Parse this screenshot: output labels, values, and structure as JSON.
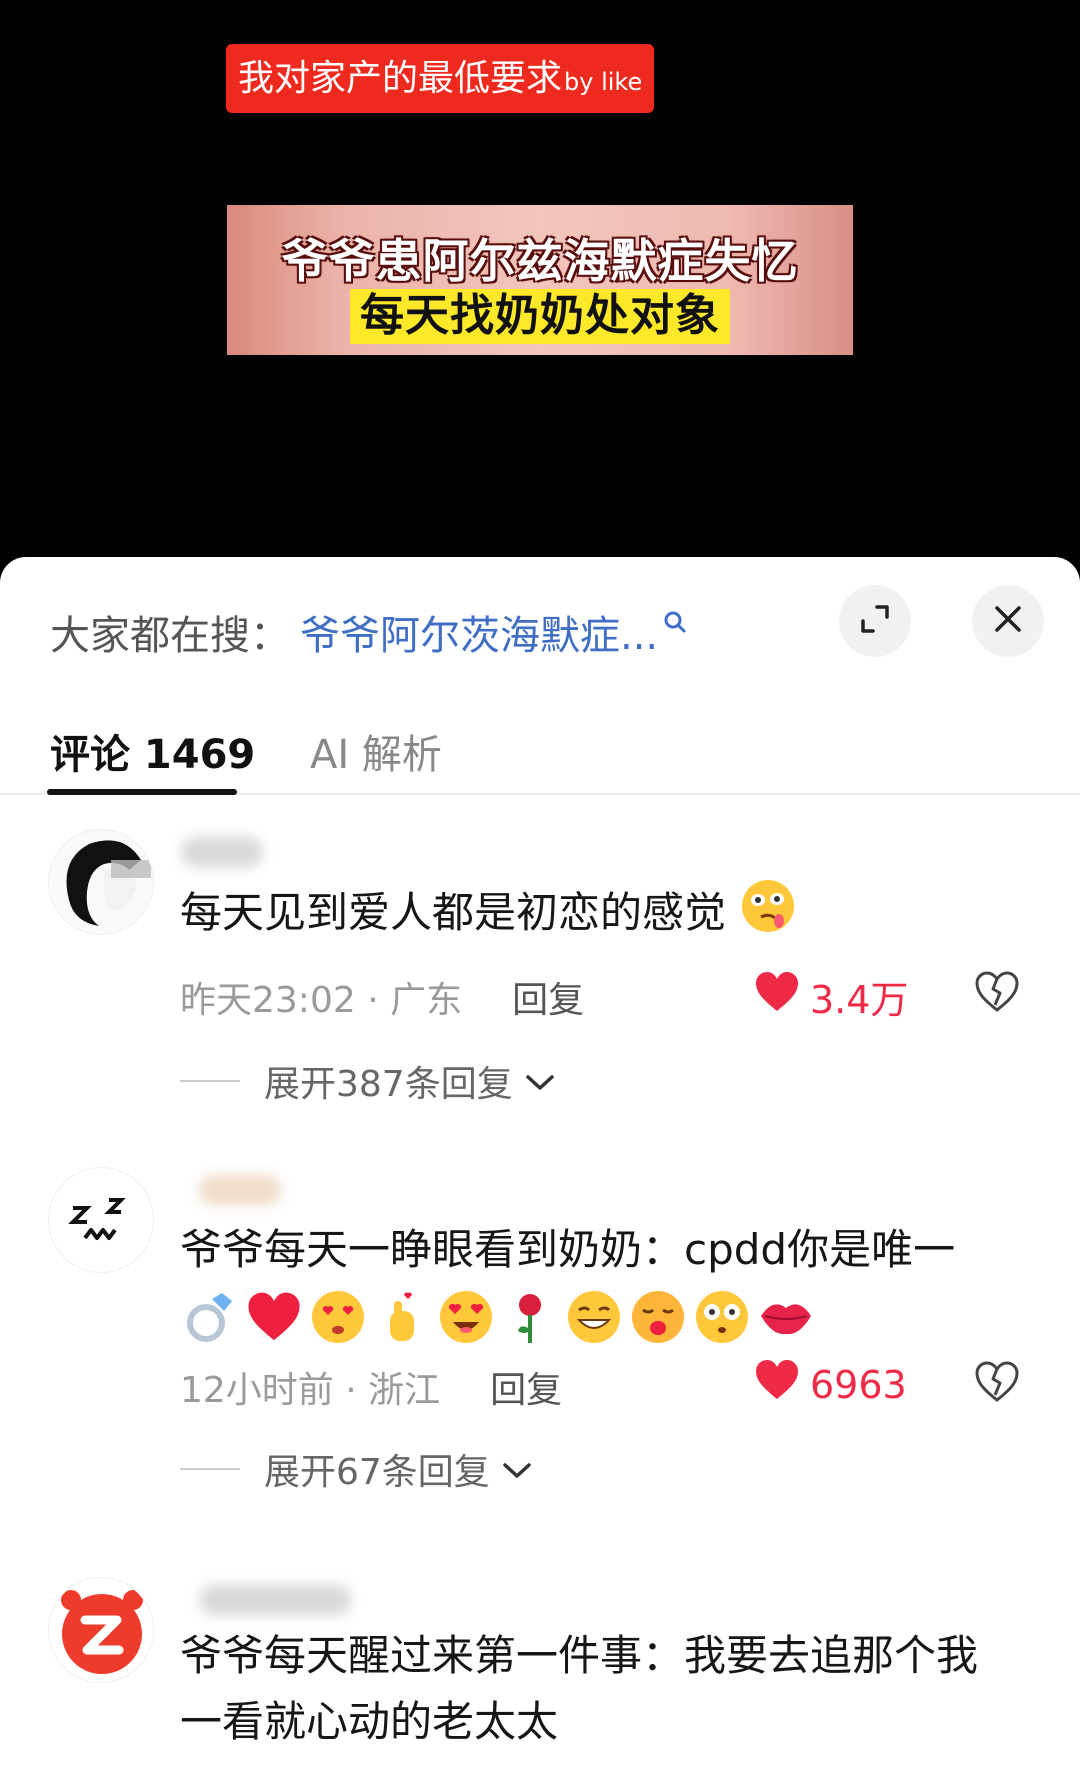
{
  "video": {
    "top_caption": "我对家产的最低要求",
    "top_caption_by": "by like",
    "headline_1": "爷爷患阿尔兹海默症失忆",
    "headline_2": "每天找奶奶处对象"
  },
  "search": {
    "prefix": "大家都在搜：",
    "query": "爷爷阿尔茨海默症...",
    "search_icon": "search-icon"
  },
  "header_buttons": {
    "expand_icon": "expand-icon",
    "close_icon": "close-icon"
  },
  "tabs": [
    {
      "label": "评论 1469",
      "active": true
    },
    {
      "label": "AI 解析",
      "active": false
    }
  ],
  "comments": [
    {
      "text": "每天见到爱人都是初恋的感觉",
      "time_location": "昨天23:02 · 广东",
      "reply_label": "回复",
      "likes": "3.4万",
      "expand_label": "展开387条回复"
    },
    {
      "text": "爷爷每天一睁眼看到奶奶：cpdd你是唯一",
      "emojis": [
        "ring-icon",
        "heart-icon",
        "heart-eyes-kiss-icon",
        "finger-heart-icon",
        "heart-eyes-icon",
        "rose-icon",
        "grin-icon",
        "kiss-icon",
        "star-eyes-icon",
        "lips-icon"
      ],
      "time_location": "12小时前 · 浙江",
      "reply_label": "回复",
      "likes": "6963",
      "expand_label": "展开67条回复"
    },
    {
      "text": "爷爷每天醒过来第一件事：我要去追那个我一看就心动的老太太"
    }
  ],
  "colors": {
    "accent_red": "#ee2a46",
    "search_blue": "#3f6ec4",
    "caption_red": "#ee2a1f",
    "headline_yellow": "#fde82a"
  }
}
